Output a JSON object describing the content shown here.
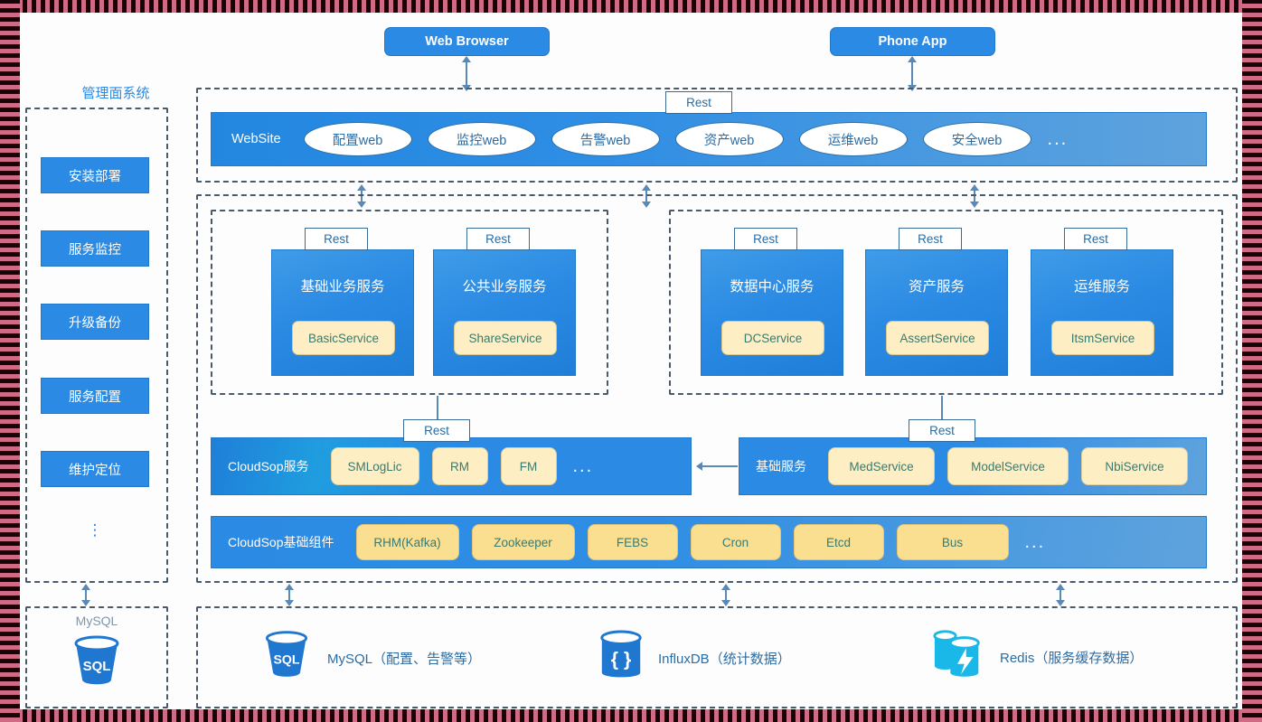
{
  "clients": [
    {
      "id": "web-browser",
      "label": "Web Browser"
    },
    {
      "id": "phone-app",
      "label": "Phone App"
    }
  ],
  "sidebar": {
    "title": "管理面系统",
    "items": [
      {
        "label": "安装部署"
      },
      {
        "label": "服务监控"
      },
      {
        "label": "升级备份"
      },
      {
        "label": "服务配置"
      },
      {
        "label": "维护定位"
      }
    ],
    "more": "⋮",
    "database": {
      "title": "MySQL",
      "icon": "sql-cylinder-icon",
      "icon_label": "SQL"
    }
  },
  "website": {
    "rest_tag": "Rest",
    "title": "WebSite",
    "modules": [
      {
        "label": "配置web"
      },
      {
        "label": "监控web"
      },
      {
        "label": "告警web"
      },
      {
        "label": "资产web"
      },
      {
        "label": "运维web"
      },
      {
        "label": "安全web"
      }
    ],
    "more": "..."
  },
  "services": {
    "group_left": [
      {
        "rest_tag": "Rest",
        "title": "基础业务服务",
        "pill": "BasicService"
      },
      {
        "rest_tag": "Rest",
        "title": "公共业务服务",
        "pill": "ShareService"
      }
    ],
    "group_right": [
      {
        "rest_tag": "Rest",
        "title": "数据中心服务",
        "pill": "DCService"
      },
      {
        "rest_tag": "Rest",
        "title": "资产服务",
        "pill": "AssertService"
      },
      {
        "rest_tag": "Rest",
        "title": "运维服务",
        "pill": "ItsmService"
      }
    ]
  },
  "cloudsop_service": {
    "rest_tag": "Rest",
    "title": "CloudSop服务",
    "chips": [
      {
        "label": "SMLogLic"
      },
      {
        "label": "RM"
      },
      {
        "label": "FM"
      }
    ],
    "more": "..."
  },
  "base_service": {
    "rest_tag": "Rest",
    "title": "基础服务",
    "chips": [
      {
        "label": "MedService"
      },
      {
        "label": "ModelService"
      },
      {
        "label": "NbiService"
      }
    ]
  },
  "cloudsop_components": {
    "title": "CloudSop基础组件",
    "chips": [
      {
        "label": "RHM(Kafka)"
      },
      {
        "label": "Zookeeper"
      },
      {
        "label": "FEBS"
      },
      {
        "label": "Cron"
      },
      {
        "label": "Etcd"
      },
      {
        "label": "Bus"
      }
    ],
    "more": "..."
  },
  "datastores": [
    {
      "icon": "sql-cylinder-icon",
      "icon_label": "SQL",
      "label": "MySQL（配置、告警等）"
    },
    {
      "icon": "influxdb-cylinder-icon",
      "icon_label": "{ }",
      "label": "InfluxDB（统计数据）"
    },
    {
      "icon": "redis-cylinder-icon",
      "icon_label": "⚡",
      "label": "Redis（服务缓存数据）"
    }
  ],
  "colors": {
    "primary_blue": "#2b8ae3",
    "pill_yellow": "#fbdf91",
    "pill_cream": "#fdeec4",
    "dash_gray": "#4a5a6a",
    "arrow_blue": "#5b89b5",
    "text_blue": "#2b6ca3",
    "border_pink": "#cf6b84"
  }
}
